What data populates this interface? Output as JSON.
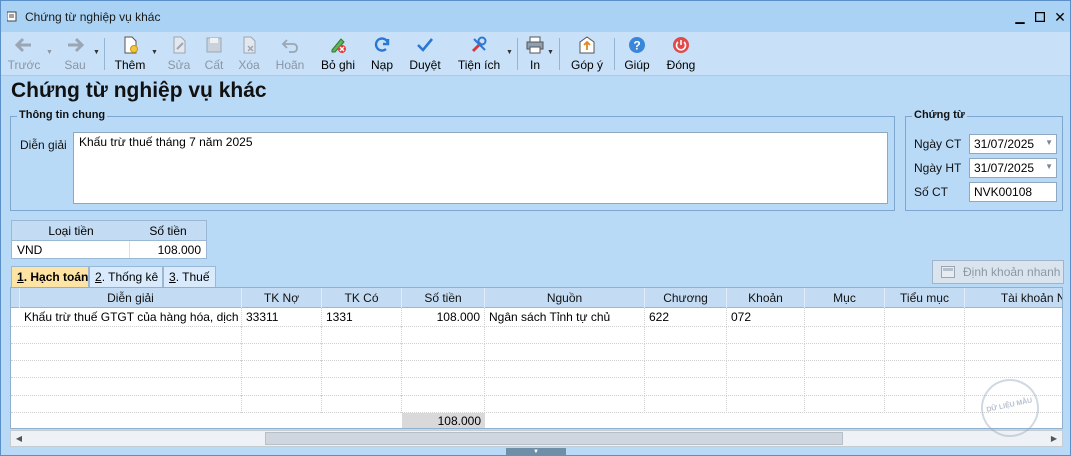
{
  "window": {
    "title": "Chứng từ nghiệp vụ khác",
    "controls": [
      "minimize-icon",
      "maximize-icon",
      "close-icon"
    ]
  },
  "toolbar": {
    "prev": "Trước",
    "next": "Sau",
    "add": "Thêm",
    "edit": "Sửa",
    "save": "Cất",
    "delete": "Xóa",
    "undo": "Hoãn",
    "unpost": "Bỏ ghi",
    "reload": "Nạp",
    "approve": "Duyệt",
    "utilities": "Tiện ích",
    "print": "In",
    "feedback": "Góp ý",
    "help": "Giúp",
    "close": "Đóng"
  },
  "page_title": "Chứng từ nghiệp vụ khác",
  "general_info": {
    "group_title": "Thông tin chung",
    "description_label": "Diễn giải",
    "description_value": "Khấu trừ thuế tháng 7 năm 2025"
  },
  "voucher": {
    "group_title": "Chứng từ",
    "voucher_date_label": "Ngày CT",
    "voucher_date_value": "31/07/2025",
    "posting_date_label": "Ngày HT",
    "posting_date_value": "31/07/2025",
    "voucher_no_label": "Số CT",
    "voucher_no_value": "NVK00108"
  },
  "currency_table": {
    "headers": [
      "Loại tiền",
      "Số tiền"
    ],
    "row": [
      "VND",
      "108.000"
    ]
  },
  "tabs": [
    {
      "num": "1",
      "label": ". Hạch toán"
    },
    {
      "num": "2",
      "label": ". Thống kê"
    },
    {
      "num": "3",
      "label": ". Thuế"
    }
  ],
  "quick_entry_button": "Định khoản nhanh",
  "grid": {
    "headers": [
      "Diễn giải",
      "TK Nợ",
      "TK Có",
      "Số tiền",
      "Nguồn",
      "Chương",
      "Khoản",
      "Mục",
      "Tiểu mục",
      "Tài khoản NH"
    ],
    "row": [
      "Khấu trừ thuế GTGT của hàng hóa, dịch vụ",
      "33311",
      "1331",
      "108.000",
      "Ngân sách Tỉnh tự chủ",
      "622",
      "072",
      "",
      "",
      ""
    ],
    "total": "108.000"
  },
  "watermark": "DỮ LIỆU MẪU",
  "colors": {
    "window_bg": "#b9daf7",
    "header_bg": "#c3dcf3",
    "active_tab": "#fde4a4"
  }
}
